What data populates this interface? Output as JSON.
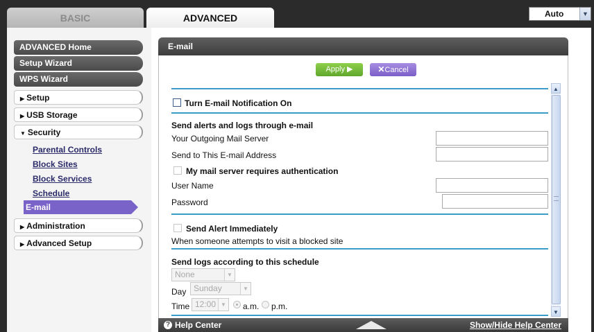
{
  "tabs": {
    "basic": "BASIC",
    "advanced": "ADVANCED"
  },
  "language_select": {
    "value": "Auto"
  },
  "sidebar": {
    "primary": [
      "ADVANCED Home",
      "Setup Wizard",
      "WPS Wizard"
    ],
    "sections": {
      "setup": "Setup",
      "usb": "USB Storage",
      "security": "Security",
      "administration": "Administration",
      "advanced_setup": "Advanced Setup"
    },
    "security_items": [
      "Parental Controls",
      "Block Sites",
      "Block Services",
      "Schedule"
    ],
    "active_item": "E-mail"
  },
  "panel": {
    "title": "E-mail",
    "apply_label": "Apply ▶",
    "cancel_label": "Cancel",
    "cancel_icon": "✕"
  },
  "form": {
    "notification_label": "Turn E-mail Notification On",
    "send_alerts_heading": "Send alerts and logs through e-mail",
    "outgoing_server_label": "Your Outgoing Mail Server",
    "outgoing_server_value": "",
    "send_to_label": "Send to This E-mail Address",
    "send_to_value": "",
    "auth_label": "My mail server requires authentication",
    "username_label": "User Name",
    "username_value": "",
    "password_label": "Password",
    "password_value": "",
    "alert_immediately_label": "Send Alert Immediately",
    "alert_desc": "When someone attempts to visit a blocked site",
    "schedule_heading": "Send logs according to this schedule",
    "schedule_value": "None",
    "day_label": "Day",
    "day_value": "Sunday",
    "time_label": "Time",
    "time_value": "12:00",
    "am_label": "a.m.",
    "pm_label": "p.m."
  },
  "help": {
    "label": "Help Center",
    "toggle": "Show/Hide Help Center"
  }
}
